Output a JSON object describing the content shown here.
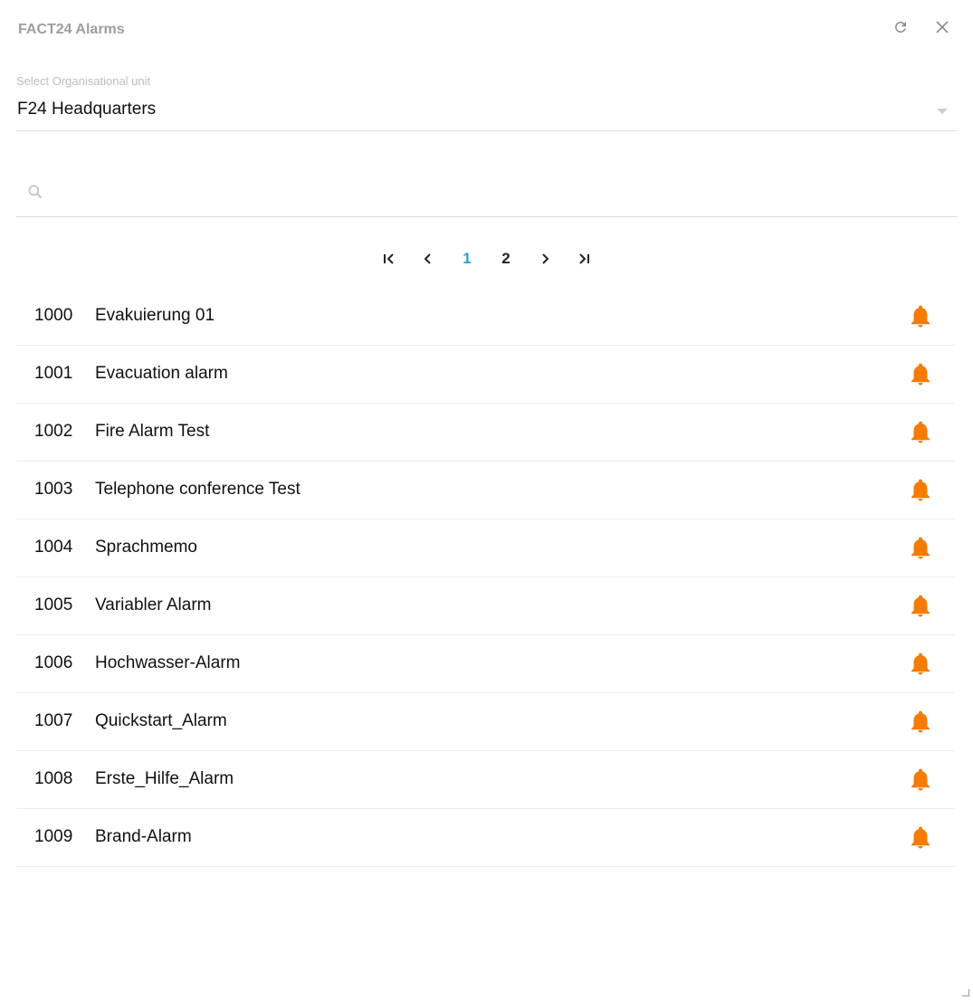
{
  "header": {
    "title": "FACT24 Alarms",
    "refresh_icon": "refresh-icon",
    "close_icon": "close-icon"
  },
  "org_select": {
    "label": "Select Organisational unit",
    "value": "F24 Headquarters"
  },
  "search": {
    "placeholder": "",
    "value": "",
    "icon": "search-icon"
  },
  "pagination": {
    "first_icon": "first-page-icon",
    "prev_icon": "prev-page-icon",
    "pages": [
      "1",
      "2"
    ],
    "current_page": "1",
    "next_icon": "next-page-icon",
    "last_icon": "last-page-icon"
  },
  "alarms": [
    {
      "number": "1000",
      "name": "Evakuierung 01"
    },
    {
      "number": "1001",
      "name": "Evacuation alarm"
    },
    {
      "number": "1002",
      "name": "Fire Alarm Test"
    },
    {
      "number": "1003",
      "name": "Telephone conference Test"
    },
    {
      "number": "1004",
      "name": "Sprachmemo"
    },
    {
      "number": "1005",
      "name": "Variabler Alarm"
    },
    {
      "number": "1006",
      "name": "Hochwasser-Alarm"
    },
    {
      "number": "1007",
      "name": "Quickstart_Alarm"
    },
    {
      "number": "1008",
      "name": "Erste_Hilfe_Alarm"
    },
    {
      "number": "1009",
      "name": "Brand-Alarm"
    }
  ],
  "colors": {
    "bell": "#f57c00",
    "active_page": "#2a9fd8",
    "title": "#9e9e9e"
  }
}
